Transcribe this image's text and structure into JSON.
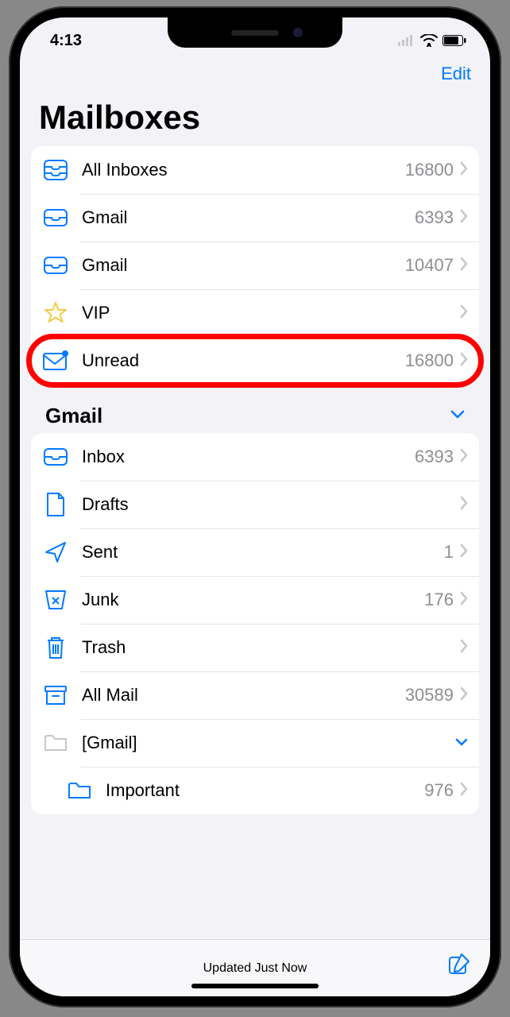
{
  "statusbar": {
    "time": "4:13"
  },
  "nav": {
    "edit": "Edit"
  },
  "page": {
    "title": "Mailboxes"
  },
  "mailboxes": [
    {
      "icon": "all-inboxes-icon",
      "label": "All Inboxes",
      "count": "16800",
      "chev": "right"
    },
    {
      "icon": "inbox-icon",
      "label": "Gmail",
      "count": "6393",
      "chev": "right"
    },
    {
      "icon": "inbox-icon",
      "label": "Gmail",
      "count": "10407",
      "chev": "right"
    },
    {
      "icon": "star-icon",
      "label": "VIP",
      "count": "",
      "chev": "right"
    },
    {
      "icon": "unread-icon",
      "label": "Unread",
      "count": "16800",
      "chev": "right",
      "highlighted": true
    }
  ],
  "account": {
    "name": "Gmail",
    "folders": [
      {
        "icon": "inbox-icon",
        "label": "Inbox",
        "count": "6393",
        "chev": "right"
      },
      {
        "icon": "drafts-icon",
        "label": "Drafts",
        "count": "",
        "chev": "right"
      },
      {
        "icon": "sent-icon",
        "label": "Sent",
        "count": "1",
        "chev": "right"
      },
      {
        "icon": "junk-icon",
        "label": "Junk",
        "count": "176",
        "chev": "right"
      },
      {
        "icon": "trash-icon",
        "label": "Trash",
        "count": "",
        "chev": "right"
      },
      {
        "icon": "archive-icon",
        "label": "All Mail",
        "count": "30589",
        "chev": "right"
      },
      {
        "icon": "folder-gray-icon",
        "label": "[Gmail]",
        "count": "",
        "chev": "down"
      },
      {
        "icon": "folder-icon",
        "label": "Important",
        "count": "976",
        "chev": "right",
        "nested": true
      }
    ]
  },
  "footer": {
    "status": "Updated Just Now"
  }
}
